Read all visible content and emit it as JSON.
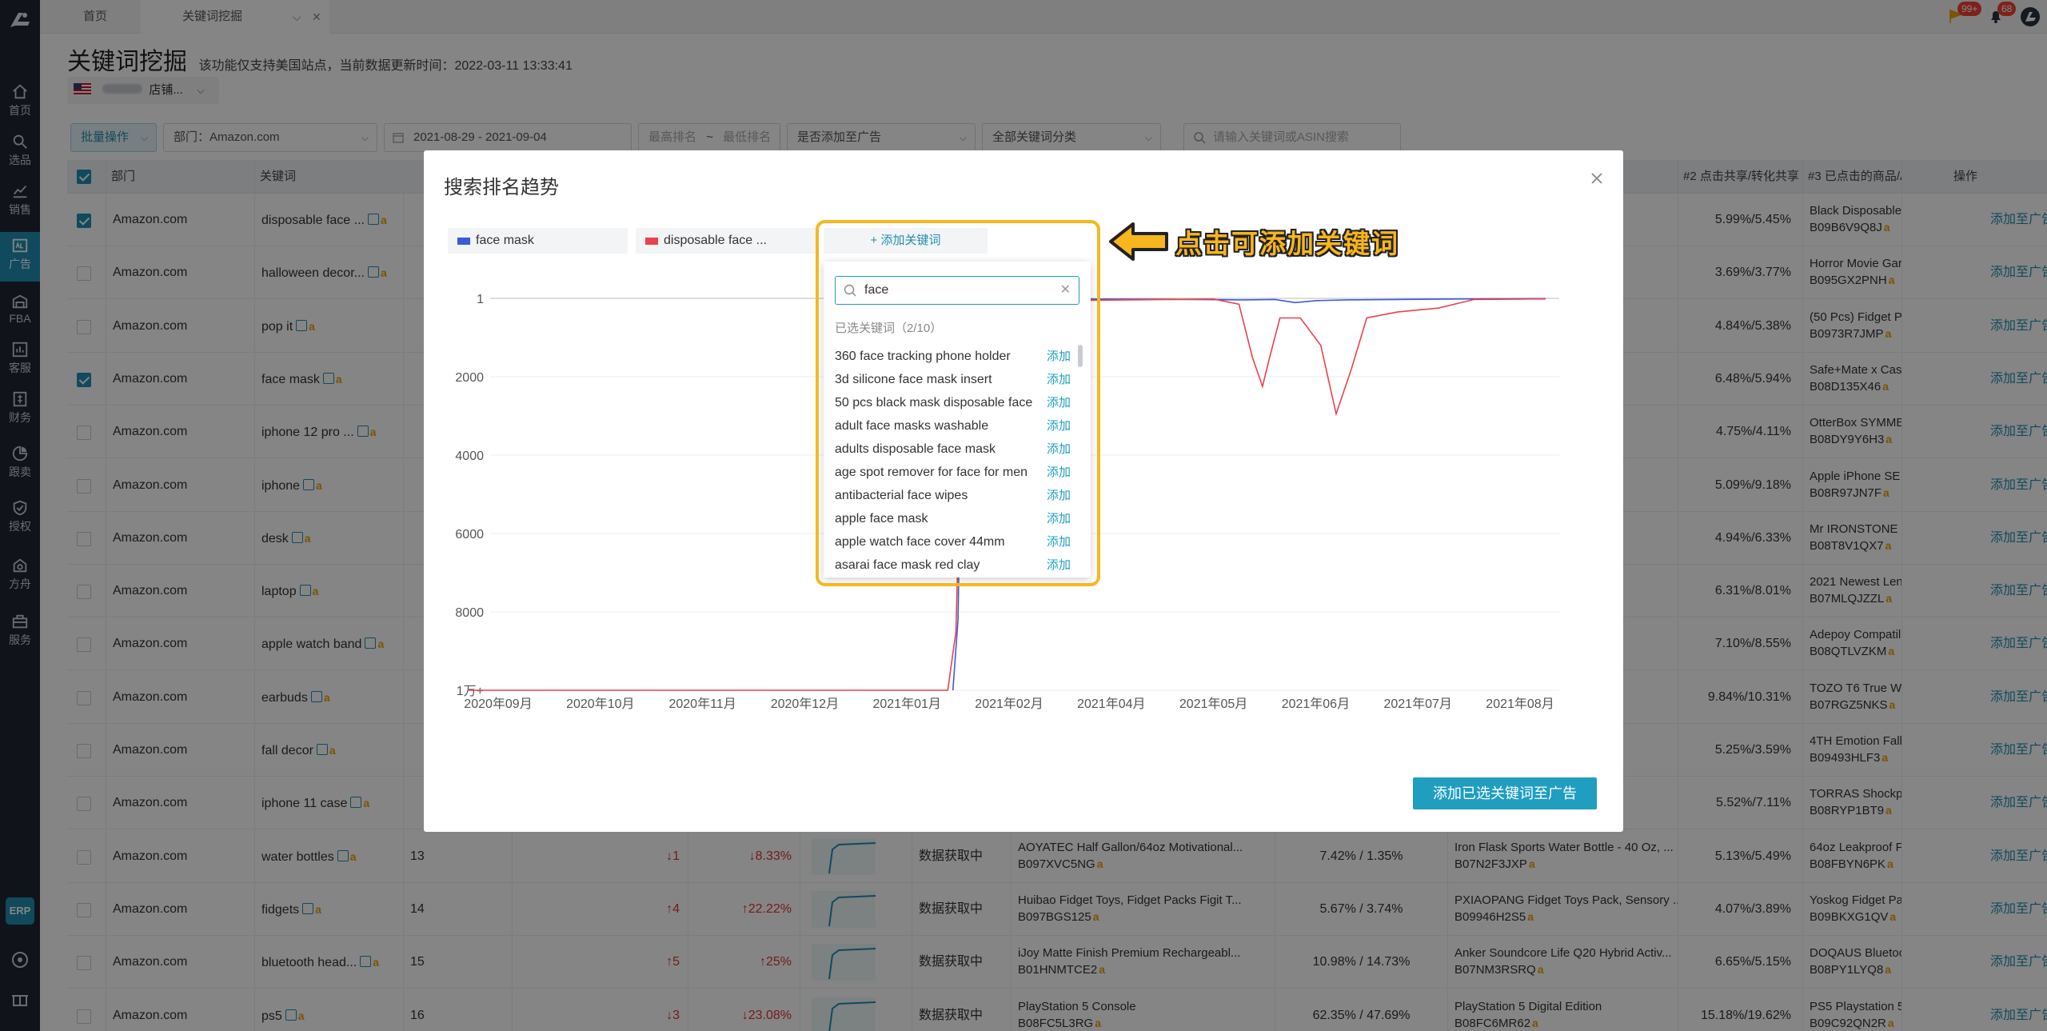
{
  "rail": {
    "items": [
      {
        "label": "首页",
        "icon": "home-icon"
      },
      {
        "label": "选品",
        "icon": "search-icon"
      },
      {
        "label": "销售",
        "icon": "trend-icon"
      },
      {
        "label": "广告",
        "icon": "ad-icon",
        "active": true
      },
      {
        "label": "FBA",
        "icon": "warehouse-icon"
      },
      {
        "label": "客服",
        "icon": "chart-icon"
      },
      {
        "label": "财务",
        "icon": "finance-icon"
      },
      {
        "label": "跟卖",
        "icon": "pie-icon"
      },
      {
        "label": "授权",
        "icon": "shield-icon"
      },
      {
        "label": "方舟",
        "icon": "ark-icon"
      },
      {
        "label": "服务",
        "icon": "service-icon"
      }
    ],
    "erp_label": "ERP"
  },
  "tabbar": {
    "tabs": [
      {
        "label": "首页"
      },
      {
        "label": "关键词挖掘"
      }
    ],
    "badge_notice": "99+",
    "badge_bell": "68"
  },
  "page": {
    "title": "关键词挖掘",
    "desc": "该功能仅支持美国站点，当前数据更新时间：2022-03-11 13:33:41",
    "store_label": "店铺..."
  },
  "filters": {
    "batch": "批量操作",
    "dept": "部门：Amazon.com",
    "date": "2021-08-29  -  2021-09-04",
    "rank_min": "最高排名",
    "rank_sep": "~",
    "rank_max": "最低排名",
    "ad_added": "是否添加至广告",
    "category": "全部关键词分类",
    "search_placeholder": "请输入关键词或ASIN搜索"
  },
  "table": {
    "headers": {
      "dept": "部门",
      "keyword": "关键词",
      "share2": "#2 点击共享/转化共享",
      "item3": "#3 已点击的商品/A",
      "op": "操作"
    },
    "add_label": "添加至广告",
    "fetching": "数据获取中",
    "rows": [
      {
        "checked": true,
        "dept": "Amazon.com",
        "keyword": "disposable face ...",
        "share": "5.99%/5.45%",
        "prod": "Black Disposable",
        "asin": "B09B6V9Q8J"
      },
      {
        "checked": false,
        "dept": "Amazon.com",
        "keyword": "halloween decor...",
        "share": "3.69%/3.77%",
        "prod": "Horror Movie Gar",
        "asin": "B095GX2PNH"
      },
      {
        "checked": false,
        "dept": "Amazon.com",
        "keyword": "pop it",
        "share": "4.84%/5.38%",
        "prod": "(50 Pcs) Fidget Po",
        "asin": "B0973R7JMP"
      },
      {
        "checked": true,
        "dept": "Amazon.com",
        "keyword": "face mask",
        "share": "6.48%/5.94%",
        "prod": "Safe+Mate x Case",
        "asin": "B08D135X46"
      },
      {
        "checked": false,
        "dept": "Amazon.com",
        "keyword": "iphone 12 pro ...",
        "share": "4.75%/4.11%",
        "prod": "OtterBox SYMME",
        "asin": "B08DY9Y6H3"
      },
      {
        "checked": false,
        "dept": "Amazon.com",
        "keyword": "iphone",
        "share": "5.09%/9.18%",
        "prod": "Apple iPhone SE (",
        "asin": "B08R97JN7F"
      },
      {
        "checked": false,
        "dept": "Amazon.com",
        "keyword": "desk",
        "share": "4.94%/6.33%",
        "prod": "Mr IRONSTONE C",
        "asin": "B08T8V1QX7"
      },
      {
        "checked": false,
        "dept": "Amazon.com",
        "keyword": "laptop",
        "share": "6.31%/8.01%",
        "prod": "2021 Newest Len",
        "asin": "B07MLQJZZL"
      },
      {
        "checked": false,
        "dept": "Amazon.com",
        "keyword": "apple watch band",
        "share": "7.10%/8.55%",
        "prod": "Adepoy Compatil",
        "asin": "B08QTLVZKM"
      },
      {
        "checked": false,
        "dept": "Amazon.com",
        "keyword": "earbuds",
        "share": "9.84%/10.31%",
        "prod": "TOZO T6 True Wi",
        "asin": "B07RGZ5NKS"
      },
      {
        "checked": false,
        "dept": "Amazon.com",
        "keyword": "fall decor",
        "share": "5.25%/3.59%",
        "prod": "4TH Emotion Fall",
        "asin": "B09493HLF3"
      },
      {
        "checked": false,
        "dept": "Amazon.com",
        "keyword": "iphone 11 case",
        "share": "5.52%/7.11%",
        "prod": "TORRAS Shockpro",
        "asin": "B08RYP1BT9"
      },
      {
        "checked": false,
        "dept": "Amazon.com",
        "keyword": "water bottles",
        "rank": "13",
        "rchg": "↓1",
        "pchg": "↓8.33%",
        "p1": "AOYATEC Half Gallon/64oz Motivational...",
        "a1": "B097XVC5NG",
        "s1": "7.42% / 1.35%",
        "p2": "Iron Flask Sports Water Bottle - 40 Oz, ...",
        "a2": "B07N2F3JXP",
        "share": "5.13%/5.49%",
        "prod": "64oz Leakproof F",
        "asin": "B08FBYN6PK"
      },
      {
        "checked": false,
        "dept": "Amazon.com",
        "keyword": "fidgets",
        "rank": "14",
        "rchg": "↑4",
        "pchg": "↑22.22%",
        "p1": "Huibao Fidget Toys, Fidget Packs Figit T...",
        "a1": "B097BGS125",
        "s1": "5.67% / 3.74%",
        "p2": "PXIAOPANG Fidget Toys Pack, Sensory ...",
        "a2": "B09946H2S5",
        "share": "4.07%/3.89%",
        "prod": "Yoskog Fidget Pa",
        "asin": "B09BKXG1QV"
      },
      {
        "checked": false,
        "dept": "Amazon.com",
        "keyword": "bluetooth head...",
        "rank": "15",
        "rchg": "↑5",
        "pchg": "↑25%",
        "p1": "iJoy Matte Finish Premium Rechargeabl...",
        "a1": "B01HNMTCE2",
        "s1": "10.98% / 14.73%",
        "p2": "Anker Soundcore Life Q20 Hybrid Activ...",
        "a2": "B07NM3RSRQ",
        "share": "6.65%/5.15%",
        "prod": "DOQAUS Bluetoo",
        "asin": "B08PY1LYQ8"
      },
      {
        "checked": false,
        "dept": "Amazon.com",
        "keyword": "ps5",
        "rank": "16",
        "rchg": "↓3",
        "pchg": "↓23.08%",
        "p1": "PlayStation 5 Console",
        "a1": "B08FC5L3RG",
        "s1": "62.35% / 47.69%",
        "p2": "PlayStation 5 Digital Edition",
        "a2": "B08FC6MR62",
        "share": "15.18%/19.62%",
        "prod": "PS5 Playstation 5",
        "asin": "B09C92QN2R"
      }
    ]
  },
  "modal": {
    "title": "搜索排名趋势",
    "chips": [
      {
        "label": "face mask",
        "color": "#3b5bdb"
      },
      {
        "label": "disposable face ...",
        "color": "#e8434e"
      }
    ],
    "add_keyword": "+ 添加关键词",
    "submit": "添加已选关键词至广告"
  },
  "dropdown": {
    "query": "face",
    "selected_label": "已选关键词（2/10）",
    "add_label": "添加",
    "items": [
      "360 face tracking phone holder",
      "3d silicone face mask insert",
      "50 pcs black mask disposable face",
      "adult face masks washable",
      "adults disposable face mask",
      "age spot remover for face for men",
      "antibacterial face wipes",
      "apple face mask",
      "apple watch face cover 44mm",
      "asarai face mask red clay"
    ]
  },
  "annotation": {
    "text": "点击可添加关键词",
    "color": "#f7b51e"
  },
  "chart_data": {
    "type": "line",
    "title": "",
    "xlabel": "",
    "ylabel": "",
    "y_inverted": true,
    "ylim": [
      1,
      10000
    ],
    "y_ticks": [
      1,
      2000,
      4000,
      6000,
      8000,
      10000
    ],
    "y_tick_labels": [
      "1",
      "2000",
      "4000",
      "6000",
      "8000",
      "1万+"
    ],
    "x_ticks": [
      "2020年09月",
      "2020年10月",
      "2020年11月",
      "2020年12月",
      "2021年01月",
      "2021年02月",
      "2021年04月",
      "2021年05月",
      "2021年06月",
      "2021年07月",
      "2021年08月"
    ],
    "grid": true,
    "legend": "top-left",
    "series": [
      {
        "name": "face mask",
        "color": "#3b5bdb",
        "points": [
          [
            4.45,
            10000
          ],
          [
            4.5,
            8200
          ],
          [
            4.55,
            400
          ],
          [
            4.6,
            30
          ],
          [
            5.5,
            20
          ],
          [
            6.5,
            25
          ],
          [
            7.3,
            40
          ],
          [
            7.6,
            30
          ],
          [
            7.8,
            110
          ],
          [
            8.0,
            60
          ],
          [
            8.3,
            40
          ],
          [
            9.5,
            15
          ],
          [
            10.0,
            10
          ],
          [
            10.25,
            8
          ]
        ]
      },
      {
        "name": "disposable face ...",
        "color": "#e8434e",
        "points": [
          [
            -0.3,
            10000
          ],
          [
            4.4,
            10000
          ],
          [
            4.48,
            8500
          ],
          [
            4.55,
            1500
          ],
          [
            4.62,
            80
          ],
          [
            7.0,
            20
          ],
          [
            7.25,
            150
          ],
          [
            7.38,
            1500
          ],
          [
            7.48,
            2250
          ],
          [
            7.55,
            1500
          ],
          [
            7.65,
            500
          ],
          [
            7.85,
            500
          ],
          [
            8.05,
            1200
          ],
          [
            8.2,
            2950
          ],
          [
            8.35,
            1800
          ],
          [
            8.5,
            500
          ],
          [
            8.8,
            350
          ],
          [
            9.2,
            250
          ],
          [
            9.55,
            30
          ],
          [
            10.0,
            20
          ],
          [
            10.25,
            15
          ]
        ]
      }
    ]
  }
}
